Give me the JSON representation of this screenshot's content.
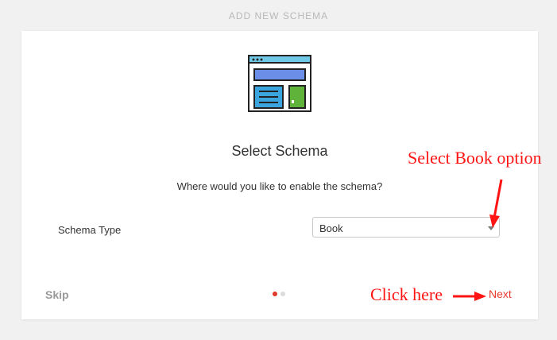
{
  "header": {
    "title": "ADD NEW SCHEMA"
  },
  "card": {
    "icon": "webpage-layout-icon",
    "title": "Select Schema",
    "subtitle": "Where would you like to enable the schema?",
    "field": {
      "label": "Schema Type",
      "selected_value": "Book"
    },
    "footer": {
      "skip_label": "Skip",
      "next_label": "Next",
      "steps_total": 2,
      "current_step": 1
    }
  },
  "annotations": {
    "select_hint": "Select Book option",
    "click_hint": "Click here"
  },
  "colors": {
    "accent": "#e83b2d",
    "annotation": "#ff1414",
    "background": "#f1f1f1"
  }
}
